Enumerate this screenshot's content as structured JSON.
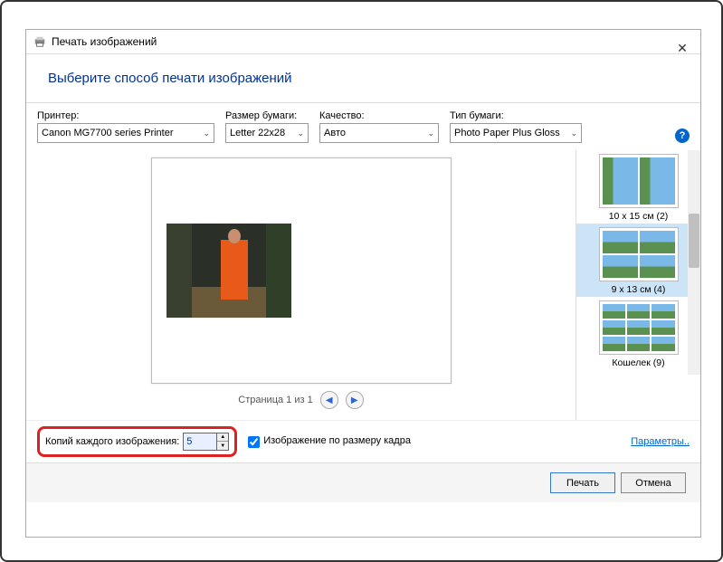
{
  "window": {
    "title": "Печать изображений",
    "header": "Выберите способ печати изображений"
  },
  "controls": {
    "printer": {
      "label": "Принтер:",
      "value": "Canon MG7700 series Printer"
    },
    "paperSize": {
      "label": "Размер бумаги:",
      "value": "Letter 22x28"
    },
    "quality": {
      "label": "Качество:",
      "value": "Авто"
    },
    "paperType": {
      "label": "Тип бумаги:",
      "value": "Photo Paper Plus Gloss"
    }
  },
  "pager": {
    "text": "Страница 1 из 1"
  },
  "layouts": [
    {
      "label": "10 x 15 см (2)"
    },
    {
      "label": "9 x 13 см (4)"
    },
    {
      "label": "Кошелек (9)"
    }
  ],
  "copies": {
    "label": "Копий каждого изображения:",
    "value": "5"
  },
  "fit": {
    "label": "Изображение по размеру кадра"
  },
  "paramsLink": "Параметры..",
  "buttons": {
    "print": "Печать",
    "cancel": "Отмена"
  }
}
